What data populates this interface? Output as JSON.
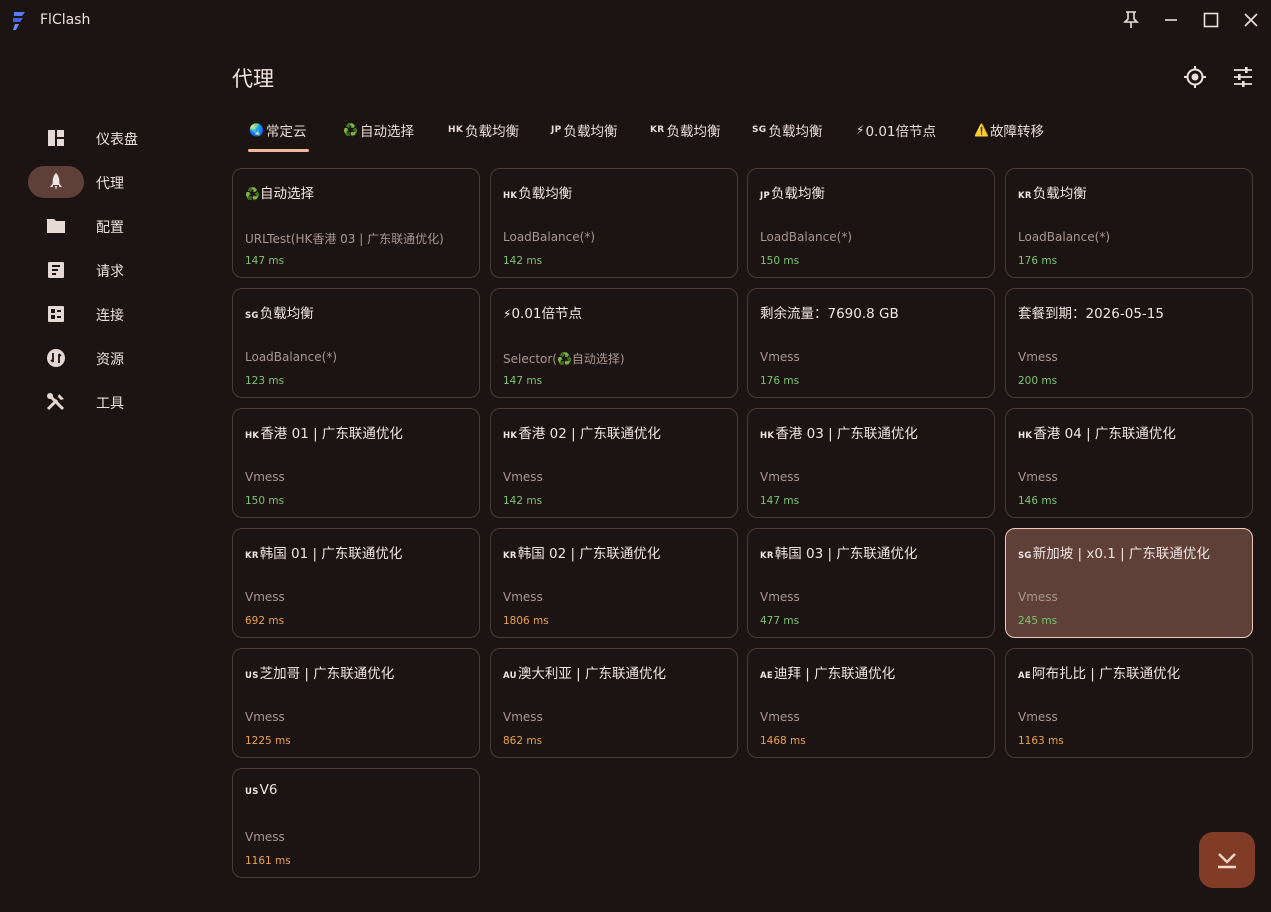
{
  "app": {
    "name": "FlClash"
  },
  "page": {
    "title": "代理"
  },
  "sidebar": {
    "items": [
      {
        "label": "仪表盘",
        "icon": "dashboard-icon"
      },
      {
        "label": "代理",
        "icon": "rocket-icon",
        "active": true
      },
      {
        "label": "配置",
        "icon": "folder-icon"
      },
      {
        "label": "请求",
        "icon": "request-icon"
      },
      {
        "label": "连接",
        "icon": "connections-icon"
      },
      {
        "label": "资源",
        "icon": "resources-icon"
      },
      {
        "label": "工具",
        "icon": "tools-icon"
      }
    ]
  },
  "tabs": [
    {
      "label": "常定云",
      "emoji": "🌏",
      "active": true
    },
    {
      "label": "自动选择",
      "emoji": "♻️"
    },
    {
      "label": "负载均衡",
      "flag": "HK"
    },
    {
      "label": "负载均衡",
      "flag": "JP"
    },
    {
      "label": "负载均衡",
      "flag": "KR"
    },
    {
      "label": "负载均衡",
      "flag": "SG"
    },
    {
      "label": "0.01倍节点",
      "emoji": "⚡"
    },
    {
      "label": "故障转移",
      "emoji": "⚠️"
    }
  ],
  "proxies": [
    {
      "emoji": "♻️",
      "flag": "",
      "name": "自动选择",
      "type": "URLTest(HK香港 03 | 广东联通优化)",
      "delay": "147 ms",
      "delay_level": "good"
    },
    {
      "emoji": "",
      "flag": "HK",
      "name": "负载均衡",
      "type": "LoadBalance(*)",
      "delay": "142 ms",
      "delay_level": "good"
    },
    {
      "emoji": "",
      "flag": "JP",
      "name": "负载均衡",
      "type": "LoadBalance(*)",
      "delay": "150 ms",
      "delay_level": "good"
    },
    {
      "emoji": "",
      "flag": "KR",
      "name": "负载均衡",
      "type": "LoadBalance(*)",
      "delay": "176 ms",
      "delay_level": "good"
    },
    {
      "emoji": "",
      "flag": "SG",
      "name": "负载均衡",
      "type": "LoadBalance(*)",
      "delay": "123 ms",
      "delay_level": "good"
    },
    {
      "emoji": "⚡",
      "flag": "",
      "name": "0.01倍节点",
      "type": "Selector(♻️自动选择)",
      "delay": "147 ms",
      "delay_level": "good"
    },
    {
      "emoji": "",
      "flag": "",
      "name": "剩余流量：7690.8 GB",
      "type": "Vmess",
      "delay": "176 ms",
      "delay_level": "good"
    },
    {
      "emoji": "",
      "flag": "",
      "name": "套餐到期：2026-05-15",
      "type": "Vmess",
      "delay": "200 ms",
      "delay_level": "good"
    },
    {
      "emoji": "",
      "flag": "HK",
      "name": "香港 01 | 广东联通优化",
      "type": "Vmess",
      "delay": "150 ms",
      "delay_level": "good"
    },
    {
      "emoji": "",
      "flag": "HK",
      "name": "香港 02 | 广东联通优化",
      "type": "Vmess",
      "delay": "142 ms",
      "delay_level": "good"
    },
    {
      "emoji": "",
      "flag": "HK",
      "name": "香港 03 | 广东联通优化",
      "type": "Vmess",
      "delay": "147 ms",
      "delay_level": "good"
    },
    {
      "emoji": "",
      "flag": "HK",
      "name": "香港 04 | 广东联通优化",
      "type": "Vmess",
      "delay": "146 ms",
      "delay_level": "good"
    },
    {
      "emoji": "",
      "flag": "KR",
      "name": "韩国 01 | 广东联通优化",
      "type": "Vmess",
      "delay": "692 ms",
      "delay_level": "mid"
    },
    {
      "emoji": "",
      "flag": "KR",
      "name": "韩国 02 | 广东联通优化",
      "type": "Vmess",
      "delay": "1806 ms",
      "delay_level": "mid"
    },
    {
      "emoji": "",
      "flag": "KR",
      "name": "韩国 03 | 广东联通优化",
      "type": "Vmess",
      "delay": "477 ms",
      "delay_level": "good"
    },
    {
      "emoji": "",
      "flag": "SG",
      "name": "新加坡 | x0.1 | 广东联通优化",
      "type": "Vmess",
      "delay": "245 ms",
      "delay_level": "good",
      "selected": true
    },
    {
      "emoji": "",
      "flag": "US",
      "name": "芝加哥 | 广东联通优化",
      "type": "Vmess",
      "delay": "1225 ms",
      "delay_level": "mid"
    },
    {
      "emoji": "",
      "flag": "AU",
      "name": "澳大利亚 | 广东联通优化",
      "type": "Vmess",
      "delay": "862 ms",
      "delay_level": "mid"
    },
    {
      "emoji": "",
      "flag": "AE",
      "name": "迪拜 | 广东联通优化",
      "type": "Vmess",
      "delay": "1468 ms",
      "delay_level": "mid"
    },
    {
      "emoji": "",
      "flag": "AE",
      "name": "阿布扎比 | 广东联通优化",
      "type": "Vmess",
      "delay": "1163 ms",
      "delay_level": "mid"
    },
    {
      "emoji": "",
      "flag": "US",
      "name": "V6",
      "type": "Vmess",
      "delay": "1161 ms",
      "delay_level": "mid"
    }
  ]
}
